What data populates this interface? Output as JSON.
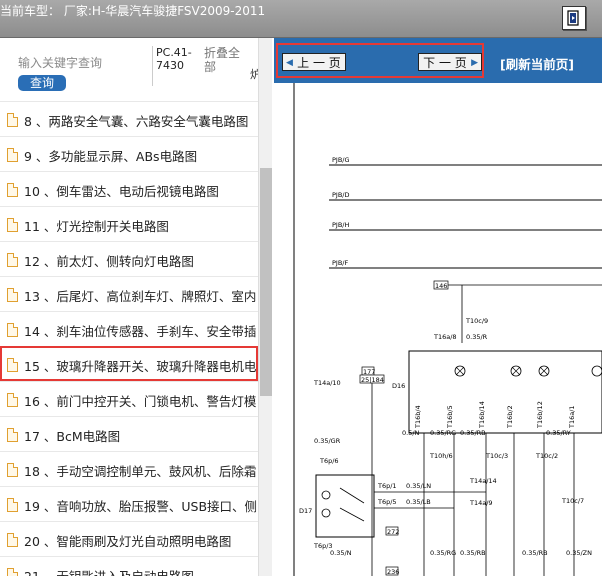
{
  "header": {
    "title": "当前车型：  厂家:H-华晨汽车骏捷FSV2009-2011",
    "exit_icon": "exit-door-icon"
  },
  "sidebar": {
    "search_placeholder": "输入关键字查询",
    "search_button": "查询",
    "car_code": "PC.41-7430",
    "fold_all": "折叠全部",
    "extra_text": "炉",
    "items": [
      {
        "label": ""
      },
      {
        "label": "8 、两路安全气囊、六路安全气囊电路图"
      },
      {
        "label": "9 、多功能显示屏、ABs电路图"
      },
      {
        "label": "10 、倒车雷达、电动后视镜电路图"
      },
      {
        "label": "11 、灯光控制开关电路图"
      },
      {
        "label": "12 、前太灯、侧转向灯电路图"
      },
      {
        "label": "13 、后尾灯、高位刹车灯、牌照灯、室内"
      },
      {
        "label": "14 、刹车油位传感器、手刹车、安全带插"
      },
      {
        "label": "15 、玻璃升降器开关、玻璃升降器电机电"
      },
      {
        "label": "16 、前门中控开关、门锁电机、警告灯模"
      },
      {
        "label": "17 、BcM电路图"
      },
      {
        "label": "18 、手动空调控制单元、鼓风机、后除霜"
      },
      {
        "label": "19 、音响功放、胎压报警、USB接口、侧"
      },
      {
        "label": "20 、智能雨刷及灯光自动照明电路图"
      },
      {
        "label": "21 、无钥匙进入及启动电路图"
      }
    ],
    "selected_index": 8
  },
  "viewer": {
    "prev_label": "上 一 页",
    "next_label": "下 一 页",
    "refresh_label": "[刷新当前页]"
  },
  "diagram_labels": {
    "bus1": "PJB/G",
    "bus2": "PJB/D",
    "bus3": "PJB/H",
    "bus4": "PJB/F",
    "c146": "146",
    "t10c9": "T10c/9",
    "t16a8": "T16a/8",
    "w035r": "0.35/R",
    "c177": "177",
    "c25184": "25|184",
    "t14a10": "T14a/10",
    "d16": "D16",
    "t16b4": "T16b/4",
    "t16b5": "T16b/5",
    "t16b14": "T16b/14",
    "t16b2": "T16b/2",
    "t16b12": "T16b/12",
    "t16a1": "T16a/1",
    "w035gr": "0.35/GR",
    "w05n": "0.5/N",
    "w035rg": "0.35/RG",
    "w035rb": "0.35/RB",
    "w035ry": "0.35/RY",
    "t10h6": "T10h/6",
    "t10c3": "T10c/3",
    "t10c2": "T10c/2",
    "t6p6": "T6p/6",
    "t14a14": "T14a/14",
    "t14a9": "T14a/9",
    "t6p1": "T6p/1",
    "w035ln": "0.35/LN",
    "t6p5": "T6p/5",
    "w035lb": "0.35/LB",
    "d17": "D17",
    "c272": "272",
    "t10c7": "T10c/7",
    "t6p3": "T6p/3",
    "w035n": "0.35/N",
    "c236": "236",
    "w035zn": "0.35/ZN"
  },
  "colors": {
    "accent": "#2a6cae",
    "highlight": "#e53935",
    "search_button": "#2a6eb6"
  }
}
